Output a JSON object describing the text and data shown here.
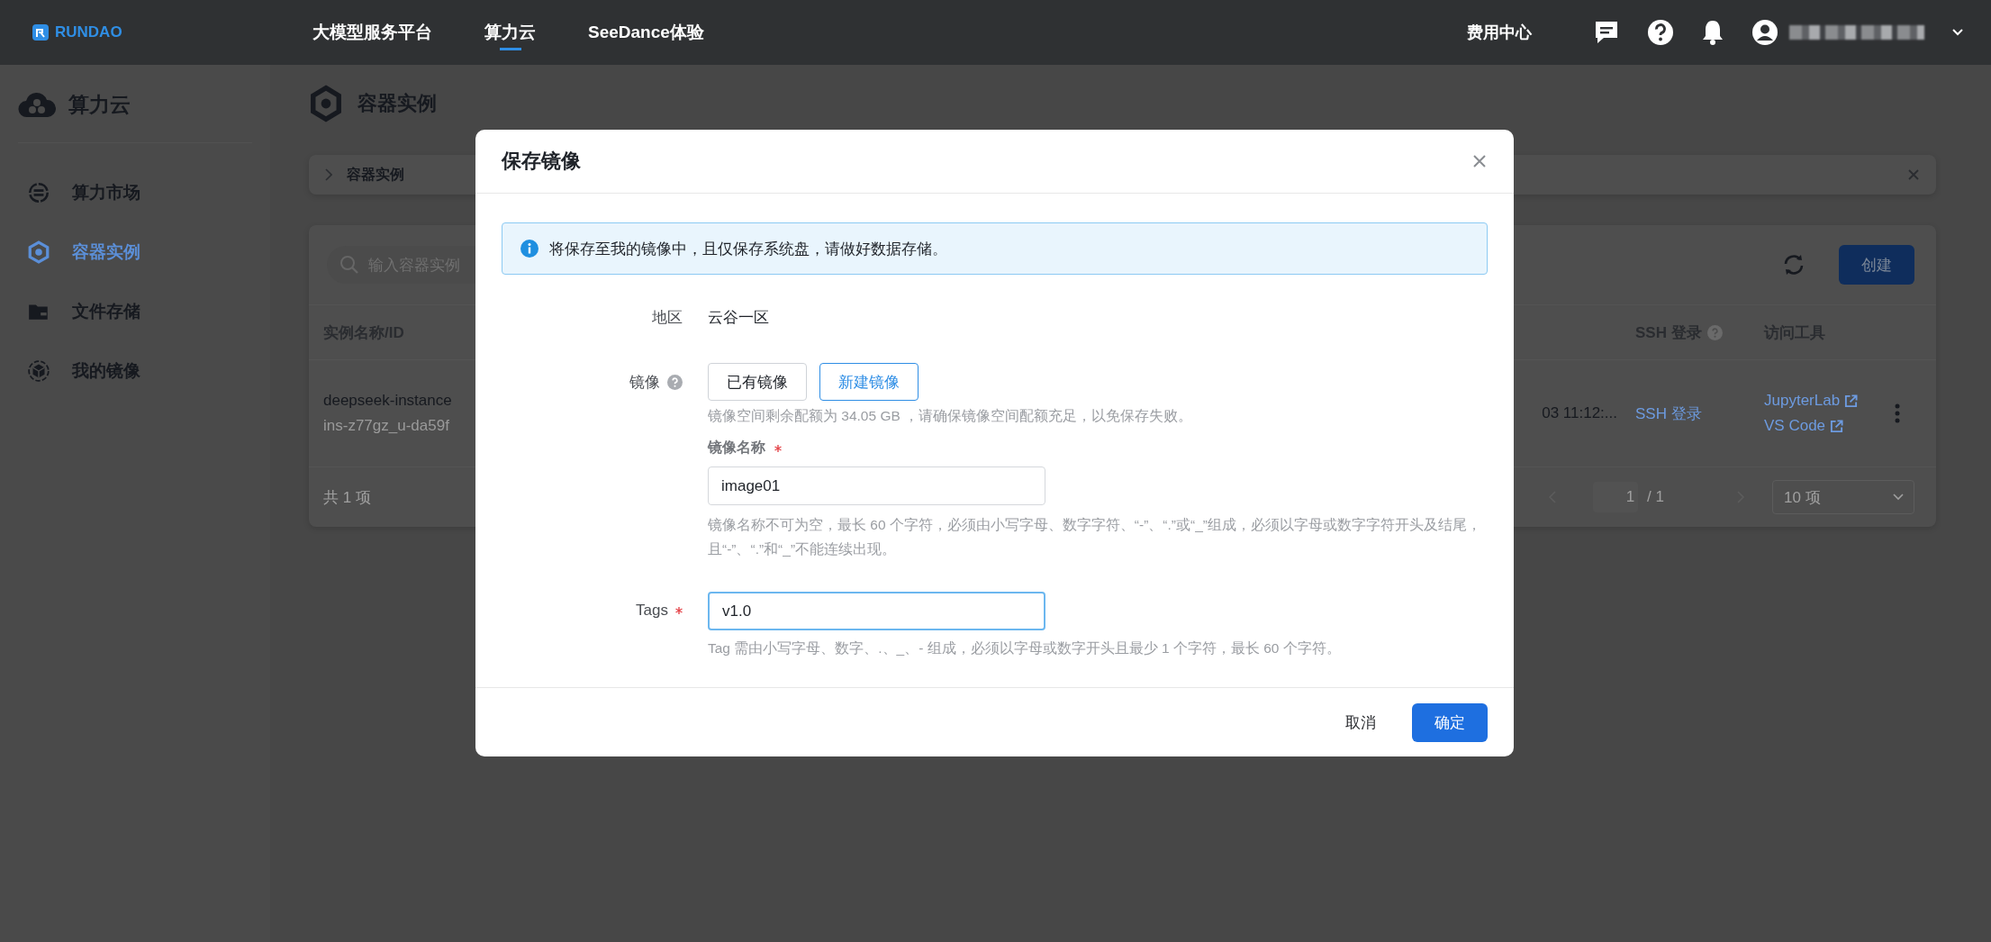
{
  "top_bar": {
    "logo": "RUNDAO",
    "nav": [
      {
        "label": "大模型服务平台",
        "selected": false
      },
      {
        "label": "算力云",
        "selected": true
      },
      {
        "label": "SeeDance体验",
        "selected": false
      }
    ],
    "billing": "费用中心"
  },
  "sidebar": {
    "title": "算力云",
    "items": [
      {
        "label": "算力市场",
        "selected": false
      },
      {
        "label": "容器实例",
        "selected": true
      },
      {
        "label": "文件存储",
        "selected": false
      },
      {
        "label": "我的镜像",
        "selected": false
      }
    ]
  },
  "page": {
    "title": "容器实例",
    "breadcrumb": "容器实例",
    "search": {
      "placeholder": "输入容器实例"
    },
    "create_button": "创建",
    "table": {
      "columns": [
        "实例名称/ID",
        "SSH 登录",
        "访问工具"
      ],
      "rows": [
        {
          "name": "deepseek-instance",
          "id": "ins-z77gz_u-da59f",
          "created": "03 11:12:...",
          "ssh": "SSH 登录",
          "tools": [
            "JupyterLab",
            "VS Code"
          ]
        }
      ]
    },
    "footer": {
      "total": "共 1 项",
      "page": "1",
      "pages": "/ 1",
      "page_size": "10 项"
    }
  },
  "dialog": {
    "title": "保存镜像",
    "alert": "将保存至我的镜像中，且仅保存系统盘，请做好数据存储。",
    "region": {
      "label": "地区",
      "value": "云谷一区"
    },
    "image": {
      "label": "镜像",
      "options": [
        {
          "label": "已有镜像",
          "selected": false
        },
        {
          "label": "新建镜像",
          "selected": true
        }
      ],
      "hint": "镜像空间剩余配额为 34.05 GB ，请确保镜像空间配额充足，以免保存失败。"
    },
    "name_field": {
      "label": "镜像名称",
      "required": true,
      "focused": false,
      "value": "image01",
      "hint": "镜像名称不可为空，最长 60 个字符，必须由小写字母、数字字符、“-”、“.”或“_”组成，必须以字母或数字字符开头及结尾，且“-”、“.”和“_”不能连续出现。"
    },
    "tags_field": {
      "label": "Tags",
      "required": true,
      "focused": true,
      "value": "v1.0",
      "hint": "Tag 需由小写字母、数字、.、_、- 组成，必须以字母或数字开头且最少 1 个字符，最长 60 个字符。"
    },
    "buttons": {
      "cancel": "取消",
      "ok": "确定"
    }
  }
}
